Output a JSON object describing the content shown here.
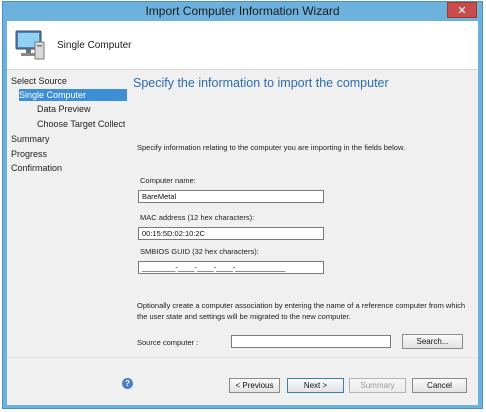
{
  "window": {
    "title": "Import Computer Information Wizard",
    "close_glyph": "✕"
  },
  "header": {
    "title": "Single Computer",
    "icon": "computer-icon"
  },
  "nav": {
    "items": [
      {
        "label": "Select Source"
      },
      {
        "label": "Single Computer"
      },
      {
        "label": "Data Preview"
      },
      {
        "label": "Choose Target Collect"
      },
      {
        "label": "Summary"
      },
      {
        "label": "Progress"
      },
      {
        "label": "Confirmation"
      }
    ]
  },
  "main": {
    "title": "Specify the information to import the computer",
    "description": "Specify information relating to the computer you are importing in the fields below.",
    "computer_name": {
      "label": "Computer name:",
      "value": "BareMetal"
    },
    "mac": {
      "label": "MAC address (12 hex characters):",
      "value": "00:15:5D:02:10:2C"
    },
    "guid": {
      "label": "SMBIOS GUID (32 hex characters):",
      "value": "________-____-____-____-____________"
    },
    "optional_text": "Optionally create a computer association by entering the name of a reference computer from which the user state and settings will be migrated to the new computer.",
    "source": {
      "label": "Source computer :",
      "value": ""
    },
    "search_label": "Search..."
  },
  "footer": {
    "help_glyph": "?",
    "previous_label": "< Previous",
    "next_label": "Next >",
    "summary_label": "Summary",
    "cancel_label": "Cancel"
  },
  "colors": {
    "accent": "#3c8fd4",
    "title_text": "#2b6cb0",
    "frame": "#6db1dd",
    "close": "#c74d4d"
  }
}
